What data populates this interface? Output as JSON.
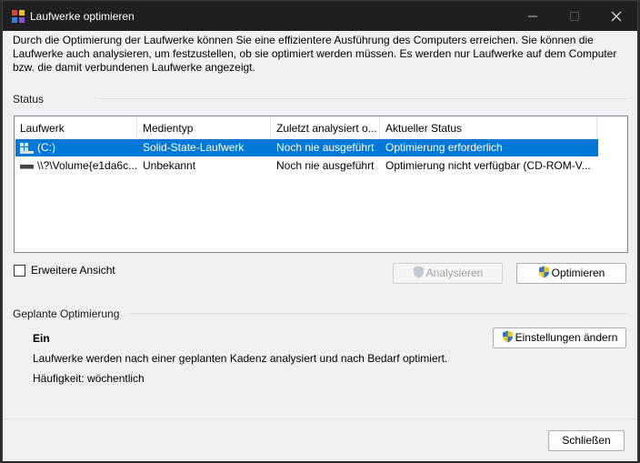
{
  "window": {
    "title": "Laufwerke optimieren"
  },
  "description": "Durch die Optimierung der Laufwerke können Sie eine effizientere Ausführung des Computers erreichen. Sie können die Laufwerke auch analysieren, um festzustellen, ob sie optimiert werden müssen. Es werden nur Laufwerke auf dem Computer bzw. die damit verbundenen Laufwerke angezeigt.",
  "status": {
    "label": "Status",
    "columns": [
      "Laufwerk",
      "Medientyp",
      "Zuletzt analysiert o...",
      "Aktueller Status"
    ],
    "rows": [
      {
        "drive": "(C:)",
        "media": "Solid-State-Laufwerk",
        "last": "Noch nie ausgeführt",
        "state": "Optimierung erforderlich",
        "selected": true,
        "icon": "windows-drive-icon"
      },
      {
        "drive": "\\\\?\\Volume{e1da6c...",
        "media": "Unbekannt",
        "last": "Noch nie ausgeführt",
        "state": "Optimierung nicht verfügbar (CD-ROM-V...",
        "selected": false,
        "icon": "removable-drive-icon"
      }
    ]
  },
  "advanced_view": {
    "label": "Erweitere Ansicht",
    "checked": false
  },
  "buttons": {
    "analyze": "Analysieren",
    "optimize": "Optimieren",
    "change_settings": "Einstellungen ändern",
    "close": "Schließen"
  },
  "scheduled": {
    "label": "Geplante Optimierung",
    "state": "Ein",
    "description": "Laufwerke werden nach einer geplanten Kadenz analysiert und nach Bedarf optimiert.",
    "frequency": "Häufigkeit: wöchentlich"
  },
  "colors": {
    "selection": "#0078d7",
    "titlebar": "#202020"
  }
}
